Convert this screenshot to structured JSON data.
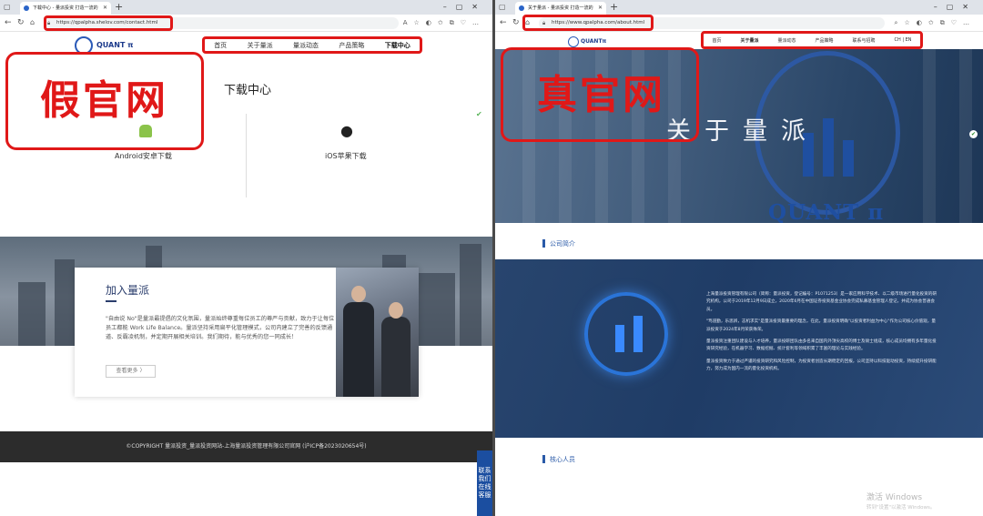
{
  "left": {
    "tab_title": "下载中心 - 量派投资 打造一流的",
    "url": "https://qpalpha.shelov.com/contact.html",
    "logo_text": "QUANT π",
    "nav": [
      "首页",
      "关于量派",
      "量派动态",
      "产品策略",
      "下载中心"
    ],
    "overlay_label": "假官网",
    "download_title": "下载中心",
    "android_label": "Android安卓下载",
    "ios_label": "iOS苹果下载",
    "card": {
      "title": "加入量派",
      "text": "\"自由说 No\"是量派最提倡的文化氛围，量派始终尊重每位员工的尊严与贡献，致力于让每位员工都能 Work Life Balance。量派坚持采用扁平化管理模式，公司内建立了完善的反馈通道、反霸凌机制，并定期开展相关培训。我们期待，能与优秀的您一同成长！",
      "more": "查看更多 〉"
    },
    "footer": "©COPYRIGHT  量派投资_量派投资网站-上海量派投资管理有限公司官网 (沪ICP备2023020654号)",
    "float_label": "联系我们 在线客服"
  },
  "right": {
    "tab_title": "关于量派 - 量派投资 打造一流的",
    "url": "https://www.qpalpha.com/about.html",
    "logo_text": "QUANTπ",
    "nav": [
      "首页",
      "关于量派",
      "量派动态",
      "产品策略",
      "联系与招聘",
      "CH | EN"
    ],
    "overlay_label": "真官网",
    "hero_title": "关于量派",
    "hero_brand": "QUANT π",
    "section_intro": "公司简介",
    "about_paragraphs": [
      "上海量派投资管理有限公司（简称：量派投资，登记编号：P1071253）是一家应用科学技术、以二级市场进行量化投资的研究机构，公司于2019年12月9日成立，2020年6月在中国证券投资基金业协会完成私募基金管理人登记，并成为协会普通会员。",
      "\"笃道勤，乐思辨，志机求实\"是量派投资最重要的理念，在此，量派投资明确\"以投资者利益为中心\"作为公司核心价值观，量派投资于2024年8月荣获殊荣。",
      "量派投资注重团队建设与人才培养，量派投研团队由多名来自国内外顶尖高校的博士及硕士组成，核心成员均拥有多年量化投资研究经验，在机器学习、数据挖掘、统计套利等领域积累了丰富的理论与实践经验。",
      "量派投资致力于通过严谨的投资研究和风险控制，为投资者创造长期稳定的回报，公司坚持以科技驱动投资，持续提升投研能力，努力成为国内一流的量化投资机构。"
    ],
    "section_team": "核心人员"
  },
  "windows_activation": {
    "line1": "激活 Windows",
    "line2": "转到\"设置\"以激活 Windows。"
  }
}
